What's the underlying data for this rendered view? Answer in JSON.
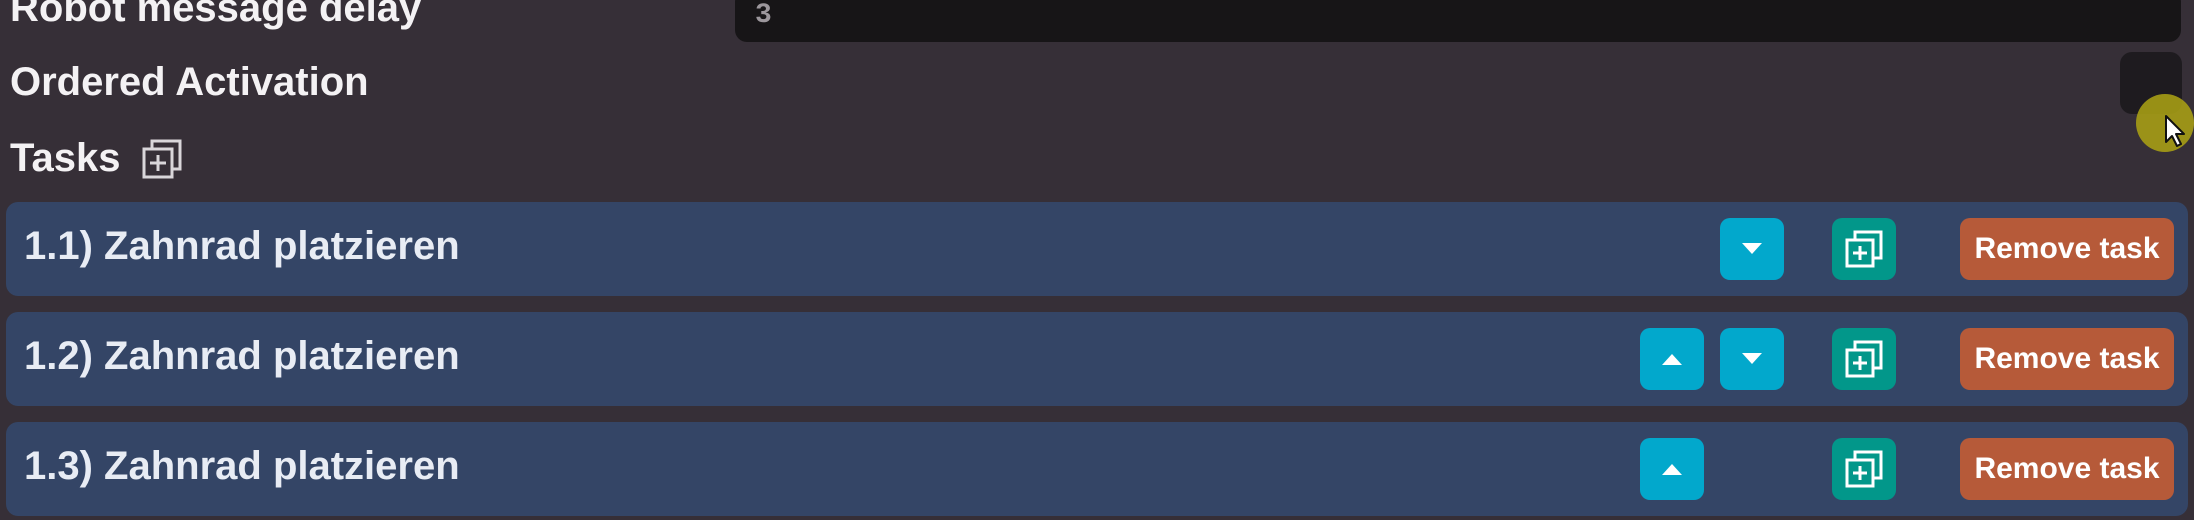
{
  "settings": {
    "delay_label": "Robot message delay",
    "delay_value": "3",
    "ordered_label": "Ordered Activation",
    "ordered_checked": false
  },
  "tasks_section": {
    "label": "Tasks",
    "add_icon": "duplicate-add-icon"
  },
  "tasks": [
    {
      "title": "1.1) Zahnrad platzieren",
      "can_move_up": false,
      "can_move_down": true,
      "remove_label": "Remove task"
    },
    {
      "title": "1.2) Zahnrad platzieren",
      "can_move_up": true,
      "can_move_down": true,
      "remove_label": "Remove task"
    },
    {
      "title": "1.3) Zahnrad platzieren",
      "can_move_up": true,
      "can_move_down": false,
      "remove_label": "Remove task"
    }
  ],
  "icons": {
    "move_up": "triangle-up-icon",
    "move_down": "triangle-down-icon",
    "duplicate": "duplicate-task-icon"
  },
  "colors": {
    "background": "#362f37",
    "task_row": "#344566",
    "move_button": "#02a8cc",
    "duplicate_button": "#02978a",
    "remove_button": "#b65a39",
    "input_background": "#171517"
  }
}
